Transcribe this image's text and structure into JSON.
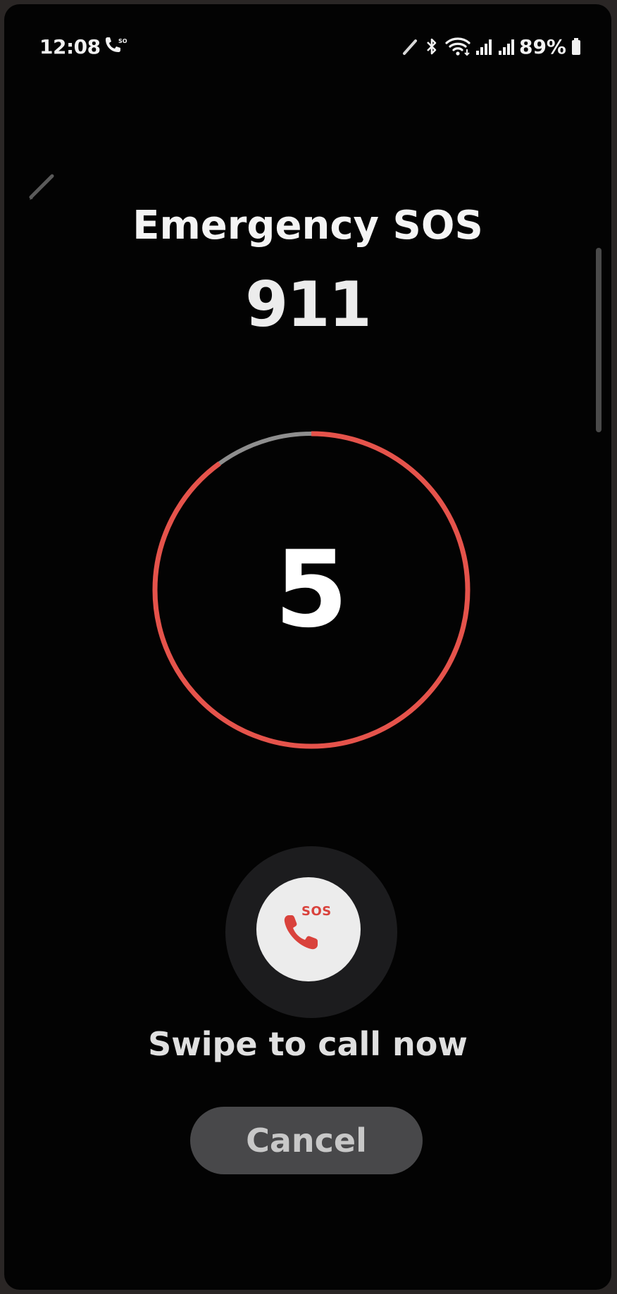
{
  "status_bar": {
    "time": "12:08",
    "battery_percent": "89%",
    "icons": [
      "sos-call-icon",
      "pen-icon",
      "bluetooth-icon",
      "wifi-icon",
      "signal-1-icon",
      "signal-2-icon",
      "battery-icon"
    ]
  },
  "emergency": {
    "title": "Emergency SOS",
    "number": "911"
  },
  "countdown": {
    "value": "5",
    "progress_fraction": 0.9,
    "ring_color": "#e5534b",
    "track_color": "#8e8e8e"
  },
  "swipe": {
    "sos_label": "SOS",
    "text": "Swipe to call now"
  },
  "cancel": {
    "label": "Cancel"
  },
  "colors": {
    "background": "#030303",
    "accent": "#e5534b",
    "text": "#f4f4f4"
  }
}
